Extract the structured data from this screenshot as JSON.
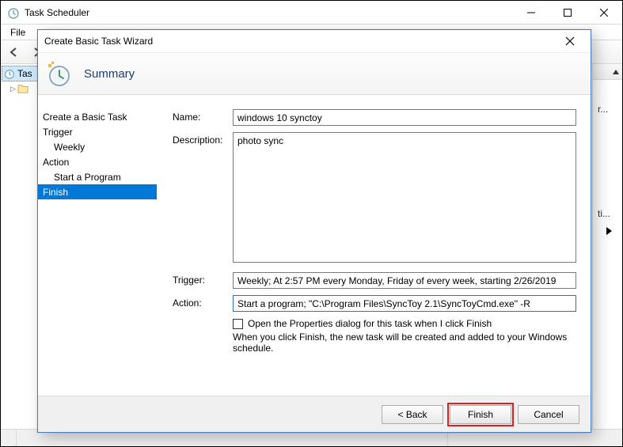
{
  "main_window": {
    "title": "Task Scheduler",
    "menu": {
      "file": "File"
    },
    "tree": {
      "root": "Tas",
      "child_icon": "folder"
    },
    "right_panel": {
      "items": [
        "r...",
        "ti...",
        ""
      ]
    }
  },
  "dialog": {
    "title": "Create Basic Task Wizard",
    "heading": "Summary",
    "steps": {
      "create": "Create a Basic Task",
      "trigger": "Trigger",
      "weekly": "Weekly",
      "action": "Action",
      "start": "Start a Program",
      "finish": "Finish"
    },
    "form": {
      "name_label": "Name:",
      "name_value": "windows 10 synctoy",
      "desc_label": "Description:",
      "desc_value": "photo sync",
      "trigger_label": "Trigger:",
      "trigger_value": "Weekly; At 2:57 PM every Monday, Friday of every week, starting 2/26/2019",
      "action_label": "Action:",
      "action_value": "Start a program; \"C:\\Program Files\\SyncToy 2.1\\SyncToyCmd.exe\" -R",
      "checkbox_label": "Open the Properties dialog for this task when I click Finish",
      "note": "When you click Finish, the new task will be created and added to your Windows schedule."
    },
    "buttons": {
      "back": "<  Back",
      "finish": "Finish",
      "cancel": "Cancel"
    }
  }
}
